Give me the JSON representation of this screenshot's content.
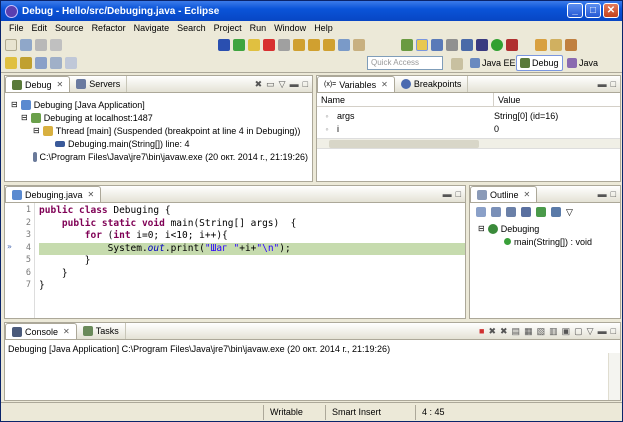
{
  "window": {
    "title": "Debug - Hello/src/Debuging.java - Eclipse",
    "btn_min": "_",
    "btn_max": "□",
    "btn_close": "✕"
  },
  "menu": [
    "File",
    "Edit",
    "Source",
    "Refactor",
    "Navigate",
    "Search",
    "Project",
    "Run",
    "Window",
    "Help"
  ],
  "toolbar": {
    "quick_access_placeholder": "Quick Access",
    "perspectives": [
      {
        "label": "Java EE"
      },
      {
        "label": "Debug"
      },
      {
        "label": "Java"
      }
    ]
  },
  "debug_view": {
    "tabs": [
      {
        "label": "Debug"
      },
      {
        "label": "Servers"
      }
    ],
    "tree": [
      "Debuging [Java Application]",
      "Debuging at localhost:1487",
      "Thread [main] (Suspended (breakpoint at line 4 in Debuging))",
      "Debuging.main(String[]) line: 4",
      "C:\\Program Files\\Java\\jre7\\bin\\javaw.exe (20 окт. 2014 г., 21:19:26)"
    ]
  },
  "variables_view": {
    "tabs": [
      {
        "label": "Variables"
      },
      {
        "label": "Breakpoints"
      }
    ],
    "col_name": "Name",
    "col_value": "Value",
    "rows": [
      {
        "name": "args",
        "value": "String[0] (id=16)"
      },
      {
        "name": "i",
        "value": "0"
      }
    ]
  },
  "editor": {
    "tab_label": "Debuging.java",
    "line_numbers": [
      "1",
      "2",
      "3",
      "4",
      "5",
      "6",
      "7"
    ],
    "lines": [
      {
        "kw": "public class",
        "text": " Debuging {"
      },
      {
        "kw": "    public static void",
        "text": " main(String[] args)  {"
      },
      {
        "kw": "        for",
        "text": " (",
        "kw2": "int",
        "text2": " i=0; i<10; i++){"
      },
      {
        "pre": "            System.",
        "it": "out",
        "mid": ".print(",
        "str": "\"Шаг \"",
        "post": "+i+",
        "str2": "\"\\n\"",
        "end": ");"
      },
      {
        "text": "        }"
      },
      {
        "text": "    }"
      },
      {
        "text": "}"
      }
    ]
  },
  "outline_view": {
    "tab_label": "Outline",
    "class_name": "Debuging",
    "method": "main(String[]) : void"
  },
  "console_view": {
    "tabs": [
      {
        "label": "Console"
      },
      {
        "label": "Tasks"
      }
    ],
    "header_line": "Debuging [Java Application] C:\\Program Files\\Java\\jre7\\bin\\javaw.exe (20 окт. 2014 г., 21:19:26)"
  },
  "status": {
    "writable": "Writable",
    "insert_mode": "Smart Insert",
    "position": "4 : 45"
  }
}
